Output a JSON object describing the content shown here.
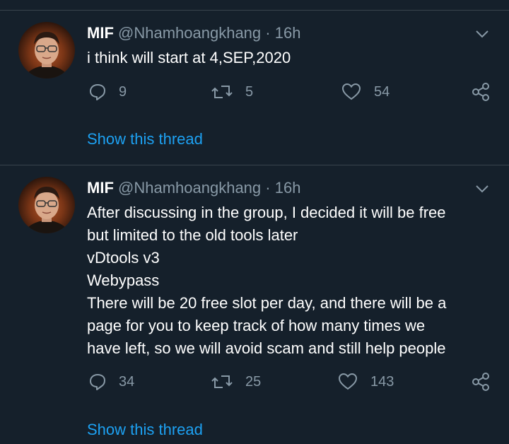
{
  "tweets": [
    {
      "name": "MIF",
      "handle": "@Nhamhoangkhang",
      "separator": "·",
      "time": "16h",
      "lines": [
        "i think  will start at 4,SEP,2020"
      ],
      "reply_count": "9",
      "retweet_count": "5",
      "like_count": "54",
      "thread_link": "Show this thread"
    },
    {
      "name": "MIF",
      "handle": "@Nhamhoangkhang",
      "separator": "·",
      "time": "16h",
      "lines": [
        "After discussing in the group, I decided it will be free",
        "but limited to the old tools later",
        "vDtools v3",
        "Webypass",
        "There will be 20 free slot  per day, and there will be a",
        "page for you to keep track of how many times we",
        "have left, so we will avoid scam  and still help people"
      ],
      "reply_count": "34",
      "retweet_count": "25",
      "like_count": "143",
      "thread_link": "Show this thread"
    }
  ],
  "colors": {
    "background": "#15202b",
    "divider": "#38444d",
    "secondary_text": "#8899a6",
    "link": "#1da1f2"
  },
  "icons": {
    "reply": "reply-icon",
    "retweet": "retweet-icon",
    "like": "heart-icon",
    "share": "share-icon",
    "menu": "chevron-down-icon"
  }
}
